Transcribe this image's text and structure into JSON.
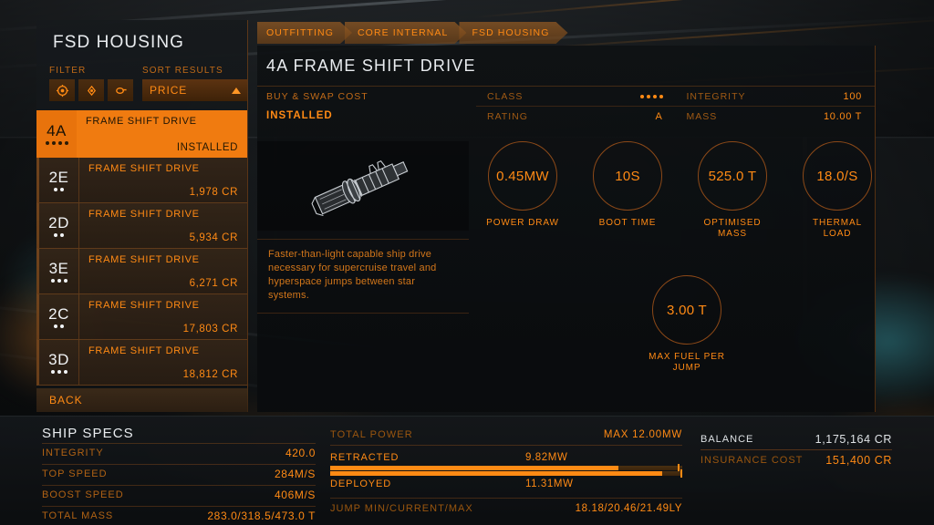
{
  "left_panel": {
    "title": "FSD HOUSING",
    "filter_label": "FILTER",
    "sort_label": "SORT RESULTS",
    "sort_value": "PRICE",
    "sort_direction_icon": "triangle-up-icon",
    "filter_icons": [
      "filter-target-icon",
      "filter-diamond-icon",
      "filter-tag-icon"
    ],
    "back_label": "BACK",
    "modules": [
      {
        "code": "4A",
        "rating_dots": 4,
        "name": "FRAME SHIFT DRIVE",
        "price": "INSTALLED",
        "selected": true
      },
      {
        "code": "2E",
        "rating_dots": 2,
        "name": "FRAME SHIFT DRIVE",
        "price": "1,978 CR",
        "selected": false
      },
      {
        "code": "2D",
        "rating_dots": 2,
        "name": "FRAME SHIFT DRIVE",
        "price": "5,934 CR",
        "selected": false
      },
      {
        "code": "3E",
        "rating_dots": 3,
        "name": "FRAME SHIFT DRIVE",
        "price": "6,271 CR",
        "selected": false
      },
      {
        "code": "2C",
        "rating_dots": 2,
        "name": "FRAME SHIFT DRIVE",
        "price": "17,803 CR",
        "selected": false
      },
      {
        "code": "3D",
        "rating_dots": 3,
        "name": "FRAME SHIFT DRIVE",
        "price": "18,812 CR",
        "selected": false
      }
    ]
  },
  "breadcrumbs": [
    "OUTFITTING",
    "CORE INTERNAL",
    "FSD HOUSING"
  ],
  "main": {
    "title": "4A FRAME SHIFT DRIVE",
    "cost_label": "BUY & SWAP COST",
    "cost_value": "INSTALLED",
    "class_label": "CLASS",
    "class_dots": 4,
    "rating_label": "RATING",
    "rating_value": "A",
    "integrity_label": "INTEGRITY",
    "integrity_value": "100",
    "mass_label": "MASS",
    "mass_value": "10.00 T",
    "module_icon": "frame-shift-drive-render",
    "description": "Faster-than-light capable ship drive necessary for supercruise travel and hyperspace jumps between star systems.",
    "gauges": [
      {
        "value": "0.45MW",
        "label": "POWER DRAW"
      },
      {
        "value": "10S",
        "label": "BOOT TIME"
      },
      {
        "value": "525.0 T",
        "label": "OPTIMISED MASS"
      },
      {
        "value": "18.0/S",
        "label": "THERMAL LOAD"
      }
    ],
    "fuel_gauge": {
      "value": "3.00 T",
      "label": "MAX FUEL PER JUMP"
    }
  },
  "ship_specs": {
    "title": "SHIP SPECS",
    "rows": [
      {
        "key": "INTEGRITY",
        "value": "420.0"
      },
      {
        "key": "TOP SPEED",
        "value": "284M/S"
      },
      {
        "key": "BOOST SPEED",
        "value": "406M/S"
      },
      {
        "key": "TOTAL MASS",
        "value": "283.0/318.5/473.0 T"
      }
    ]
  },
  "power": {
    "title": "TOTAL POWER",
    "max_label": "MAX 12.00MW",
    "retracted_label": "RETRACTED",
    "retracted_value": "9.82MW",
    "retracted_percent": 81.8,
    "deployed_label": "DEPLOYED",
    "deployed_value": "11.31MW",
    "deployed_percent": 94.3,
    "jump_label": "JUMP MIN/CURRENT/MAX",
    "jump_value": "18.18/20.46/21.49LY"
  },
  "balance": {
    "balance_label": "BALANCE",
    "balance_value": "1,175,164 CR",
    "insurance_label": "INSURANCE COST",
    "insurance_value": "151,400 CR"
  },
  "colors": {
    "accent": "#ff8a14",
    "accent_dim": "#c06a18",
    "selected_bg": "#f07b10",
    "text_light": "#e9ecef"
  }
}
